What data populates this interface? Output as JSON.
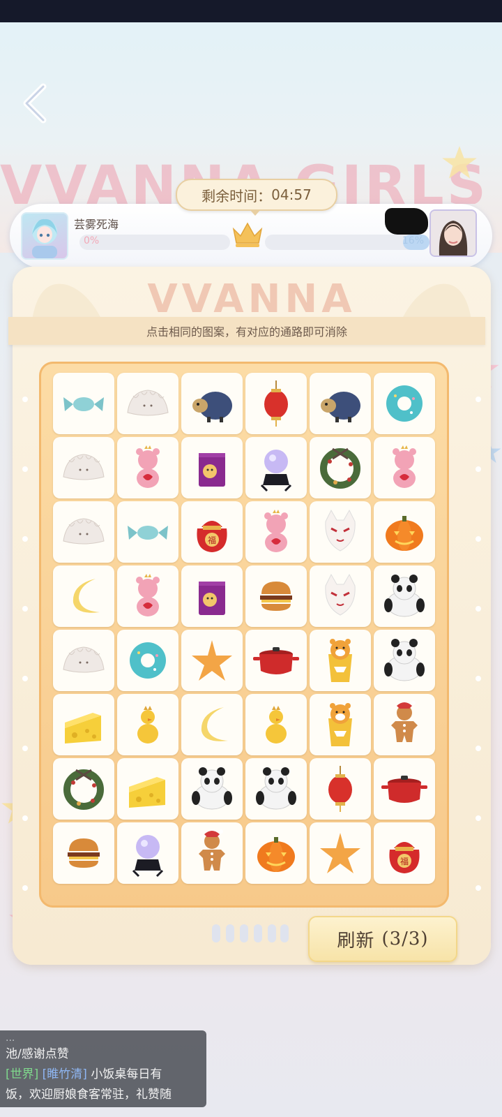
{
  "header": {
    "timer_label": "剩余时间：",
    "timer_value": "04:57",
    "background_word": "VVANNA GIRLS"
  },
  "players": {
    "left": {
      "name": "芸雾死海",
      "progress_text": "0%",
      "progress": 0
    },
    "right": {
      "name": "",
      "progress_text": "16%",
      "progress": 0.16
    }
  },
  "board": {
    "title": "VVANNA",
    "hint": "点击相同的图案，有对应的通路即可消除",
    "columns": 6,
    "rows": 8,
    "tiles": [
      [
        "candy",
        "dumpling",
        "sheep",
        "lantern",
        "sheep",
        "donut"
      ],
      [
        "dumpling",
        "bear",
        "gift-bag",
        "crystal-ball",
        "wreath",
        "bear"
      ],
      [
        "dumpling",
        "candy",
        "lucky-bag",
        "bear",
        "fox-mask",
        "pumpkin"
      ],
      [
        "moon",
        "bear",
        "gift-bag",
        "burger",
        "fox-mask",
        "panda"
      ],
      [
        "dumpling",
        "donut",
        "starfish",
        "pot",
        "tiger-cup",
        "panda"
      ],
      [
        "cheese",
        "duck",
        "moon",
        "duck",
        "tiger-cup",
        "gingerbread"
      ],
      [
        "wreath",
        "cheese",
        "panda",
        "panda",
        "lantern",
        "pot"
      ],
      [
        "burger",
        "crystal-ball",
        "gingerbread",
        "pumpkin",
        "starfish",
        "lucky-bag"
      ]
    ]
  },
  "refresh": {
    "label": "刷新",
    "count": "(3/3)"
  },
  "chat": {
    "line0": "...",
    "line1": "池/感谢点赞",
    "channel": "[世界]",
    "sender": "[睢竹清]",
    "line2_rest": "小饭桌每日有",
    "line3": "饭，欢迎厨娘食客常驻，礼赞随"
  },
  "colors": {
    "accent": "#f7c98a",
    "panel": "#fbf3e3",
    "text": "#6d5a4c"
  }
}
